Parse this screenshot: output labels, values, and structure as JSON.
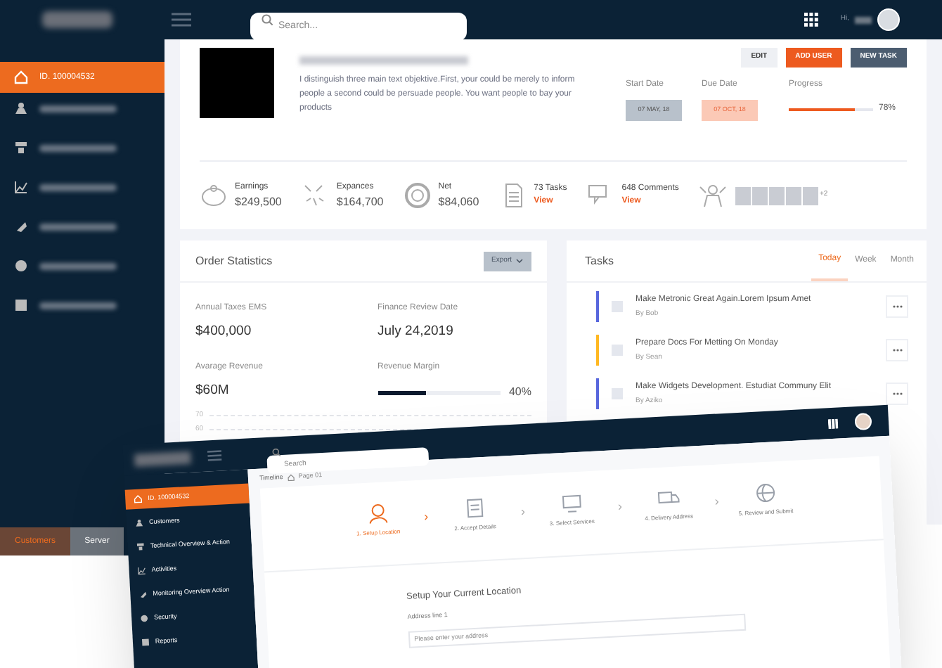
{
  "header": {
    "search_placeholder": "Search...",
    "greeting": "Hi,"
  },
  "sidebar": {
    "items": [
      {
        "label": "ID. 100004532",
        "selected": true
      },
      {
        "selected": false
      },
      {
        "selected": false
      },
      {
        "selected": false
      },
      {
        "selected": false
      },
      {
        "selected": false
      },
      {
        "selected": false
      }
    ]
  },
  "project": {
    "description": "I distinguish three main text objektive.First, your could be merely to inform people a second could be persuade people. You want people to bay your products",
    "buttons": [
      {
        "label": "EDIT",
        "kind": "plain"
      },
      {
        "label": "ADD USER",
        "kind": "primary"
      },
      {
        "label": "NEW TASK",
        "kind": "dark"
      }
    ],
    "start_date": {
      "label": "Start Date",
      "value": "07 MAY, 18"
    },
    "due_date": {
      "label": "Due Date",
      "value": "07 OCT, 18"
    },
    "progress": {
      "label": "Progress",
      "level": 0.78,
      "reading": "78%"
    }
  },
  "stats": [
    {
      "label": "Earnings",
      "value": "$249,500"
    },
    {
      "label": "Expances",
      "value": "$164,700"
    },
    {
      "label": "Net",
      "value": "$84,060"
    },
    {
      "label": "73 Tasks",
      "link": "View"
    },
    {
      "label": "648 Comments",
      "link": "View"
    }
  ],
  "team": {
    "more": "+2"
  },
  "order_statistics": {
    "title": "Order Statistics",
    "export": "Export",
    "metrics": [
      {
        "label": "Annual Taxes EMS",
        "value": "$400,000"
      },
      {
        "label": "Finance Review Date",
        "value": "July 24,2019"
      },
      {
        "label": "Avarage Revenue",
        "value": "$60M"
      }
    ],
    "margin": {
      "label": "Revenue Margin",
      "level": 0.4,
      "reading": "40%"
    },
    "axis_labels": [
      "70",
      "60"
    ]
  },
  "tasks": {
    "title": "Tasks",
    "tabs": [
      {
        "label": "Today",
        "selected": true
      },
      {
        "label": "Week",
        "selected": false
      },
      {
        "label": "Month",
        "selected": false
      }
    ],
    "items": [
      {
        "title": "Make Metronic Great Again.Lorem Ipsum Amet",
        "by": "By Bob",
        "color": "#5867dd",
        "checked": false
      },
      {
        "title": "Prepare Docs For Metting On Monday",
        "by": "By Sean",
        "color": "#ffb822",
        "checked": false
      },
      {
        "title": "Make Widgets Development. Estudiat Communy Elit",
        "by": "By Aziko",
        "color": "#5867dd",
        "checked": false
      }
    ]
  },
  "bottom_tabs": [
    {
      "label": "Customers",
      "selected": true
    },
    {
      "label": "Server",
      "selected": false
    }
  ],
  "second_window": {
    "search_placeholder": "Search",
    "step_separator": "›",
    "breadcrumb": "Timeline",
    "breadcrumb_page": "Page 01",
    "steps": [
      {
        "label": "1. Setup Location",
        "selected": true
      },
      {
        "label": "2. Accept Details",
        "selected": false
      },
      {
        "label": "3. Select Services",
        "selected": false
      },
      {
        "label": "4. Delivery Address",
        "selected": false
      },
      {
        "label": "5. Review and Submit",
        "selected": false
      }
    ],
    "sidebar": [
      {
        "label": "ID. 100004532",
        "selected": true
      },
      {
        "label": "Customers",
        "selected": false
      },
      {
        "label": "Technical Overview & Action",
        "selected": false
      },
      {
        "label": "Activities",
        "selected": false
      },
      {
        "label": "Monitoring Overview Action",
        "selected": false
      },
      {
        "label": "Security",
        "selected": false
      },
      {
        "label": "Reports",
        "selected": false
      }
    ],
    "form_title": "Setup Your Current Location",
    "field_label": "Address line 1",
    "field_hint": "Please enter your address"
  }
}
